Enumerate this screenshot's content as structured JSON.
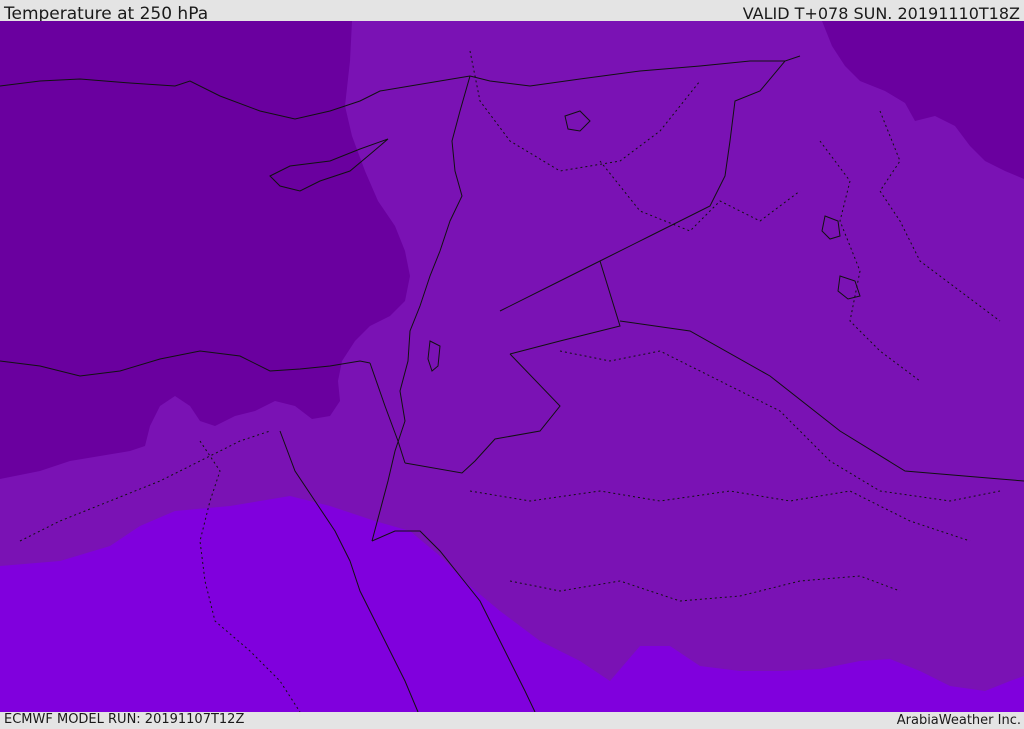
{
  "header": {
    "title": "Temperature at 250 hPa",
    "valid": "VALID T+078 SUN. 20191110T18Z"
  },
  "footer": {
    "model_run": "ECMWF MODEL RUN: 20191107T12Z",
    "credit": "ArabiaWeather Inc."
  },
  "map": {
    "colors": {
      "cold_band": "#6a009f",
      "mid_band": "#7a12b4",
      "warm_band": "#8000dd",
      "borders": "#111111"
    }
  }
}
